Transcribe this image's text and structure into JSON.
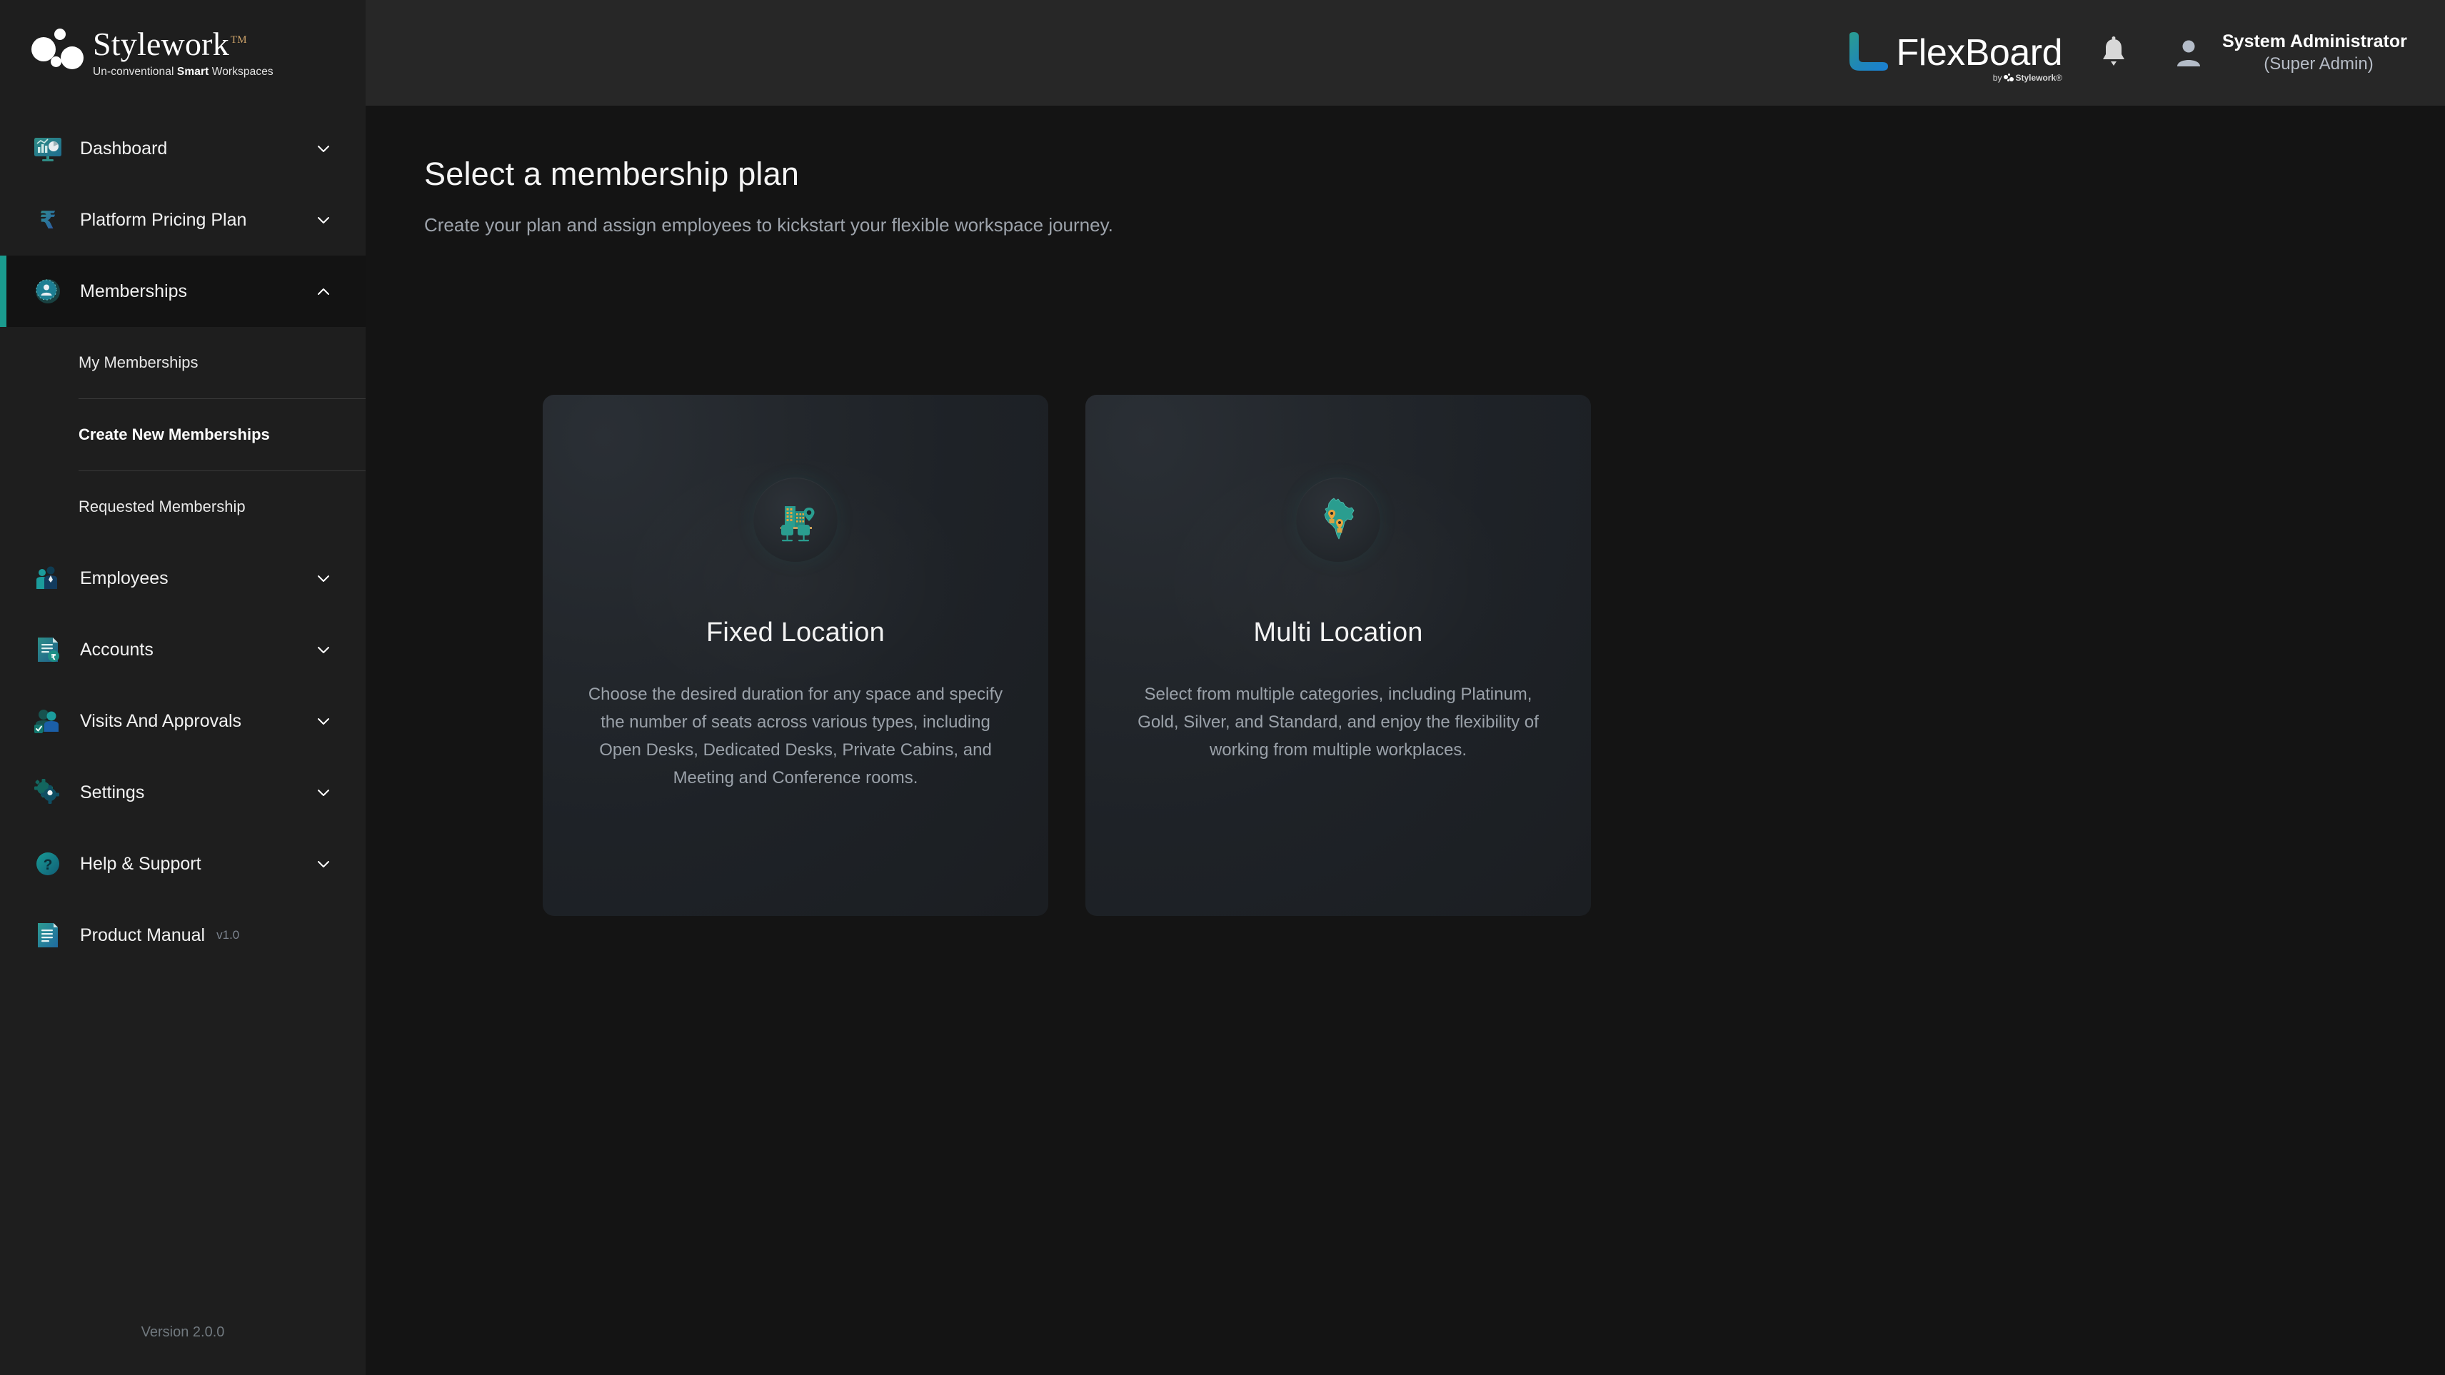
{
  "brand": {
    "name": "Stylework",
    "tm": "TM",
    "tagline_pre": "Un-conventional ",
    "tagline_bold": "Smart",
    "tagline_post": " Workspaces"
  },
  "sidebar": {
    "version_label": "Version 2.0.0",
    "items": [
      {
        "label": "Dashboard",
        "icon": "dashboard-monitor-icon",
        "chevron": "chevron-down",
        "expanded": false,
        "active": false
      },
      {
        "label": "Platform Pricing Plan",
        "icon": "rupee-icon",
        "chevron": "chevron-down",
        "expanded": false,
        "active": false
      },
      {
        "label": "Memberships",
        "icon": "membership-person-icon",
        "chevron": "chevron-up",
        "expanded": true,
        "active": true
      },
      {
        "label": "Employees",
        "icon": "employees-people-icon",
        "chevron": "chevron-down",
        "expanded": false,
        "active": false
      },
      {
        "label": "Accounts",
        "icon": "accounts-invoice-icon",
        "chevron": "chevron-down",
        "expanded": false,
        "active": false
      },
      {
        "label": "Visits And Approvals",
        "icon": "visits-approval-icon",
        "chevron": "chevron-down",
        "expanded": false,
        "active": false
      },
      {
        "label": "Settings",
        "icon": "gear-icon",
        "chevron": "chevron-down",
        "expanded": false,
        "active": false
      },
      {
        "label": "Help & Support",
        "icon": "question-circle-icon",
        "chevron": "chevron-down",
        "expanded": false,
        "active": false
      },
      {
        "label": "Product Manual",
        "icon": "manual-book-icon",
        "chevron": "none",
        "expanded": false,
        "active": false,
        "version": "v1.0"
      }
    ],
    "memberships_submenu": [
      {
        "label": "My Memberships",
        "active": false
      },
      {
        "label": "Create New Memberships",
        "active": true
      },
      {
        "label": "Requested Membership",
        "active": false
      }
    ]
  },
  "topbar": {
    "product_name": "FlexBoard",
    "product_by_prefix": "by",
    "product_by_brand": "Stylework",
    "product_by_tm": "®",
    "notification_icon": "bell-icon",
    "user_icon": "user-avatar-icon",
    "user_name": "System Administrator",
    "user_role": "(Super Admin)"
  },
  "page": {
    "title": "Select a membership plan",
    "subtitle": "Create your plan and assign employees to kickstart your flexible workspace journey."
  },
  "plans": [
    {
      "id": "fixed-location",
      "icon": "building-seats-location-icon",
      "title": "Fixed Location",
      "description": "Choose the desired duration for any space and specify the number of seats across various types, including Open Desks, Dedicated Desks, Private Cabins, and Meeting and Conference rooms."
    },
    {
      "id": "multi-location",
      "icon": "india-map-pins-icon",
      "title": "Multi Location",
      "description": "Select from multiple categories, including Platinum, Gold, Silver, and Standard, and enjoy the flexibility of working from multiple workplaces."
    }
  ],
  "colors": {
    "accent_teal": "#1a9c8f",
    "icon_teal": "#2a9d8f",
    "icon_amber": "#e8a33d",
    "logo_blue": "#1a7fd4",
    "sidebar_bg": "#1e1e1e",
    "topbar_bg": "#272727",
    "content_bg": "#141414"
  }
}
